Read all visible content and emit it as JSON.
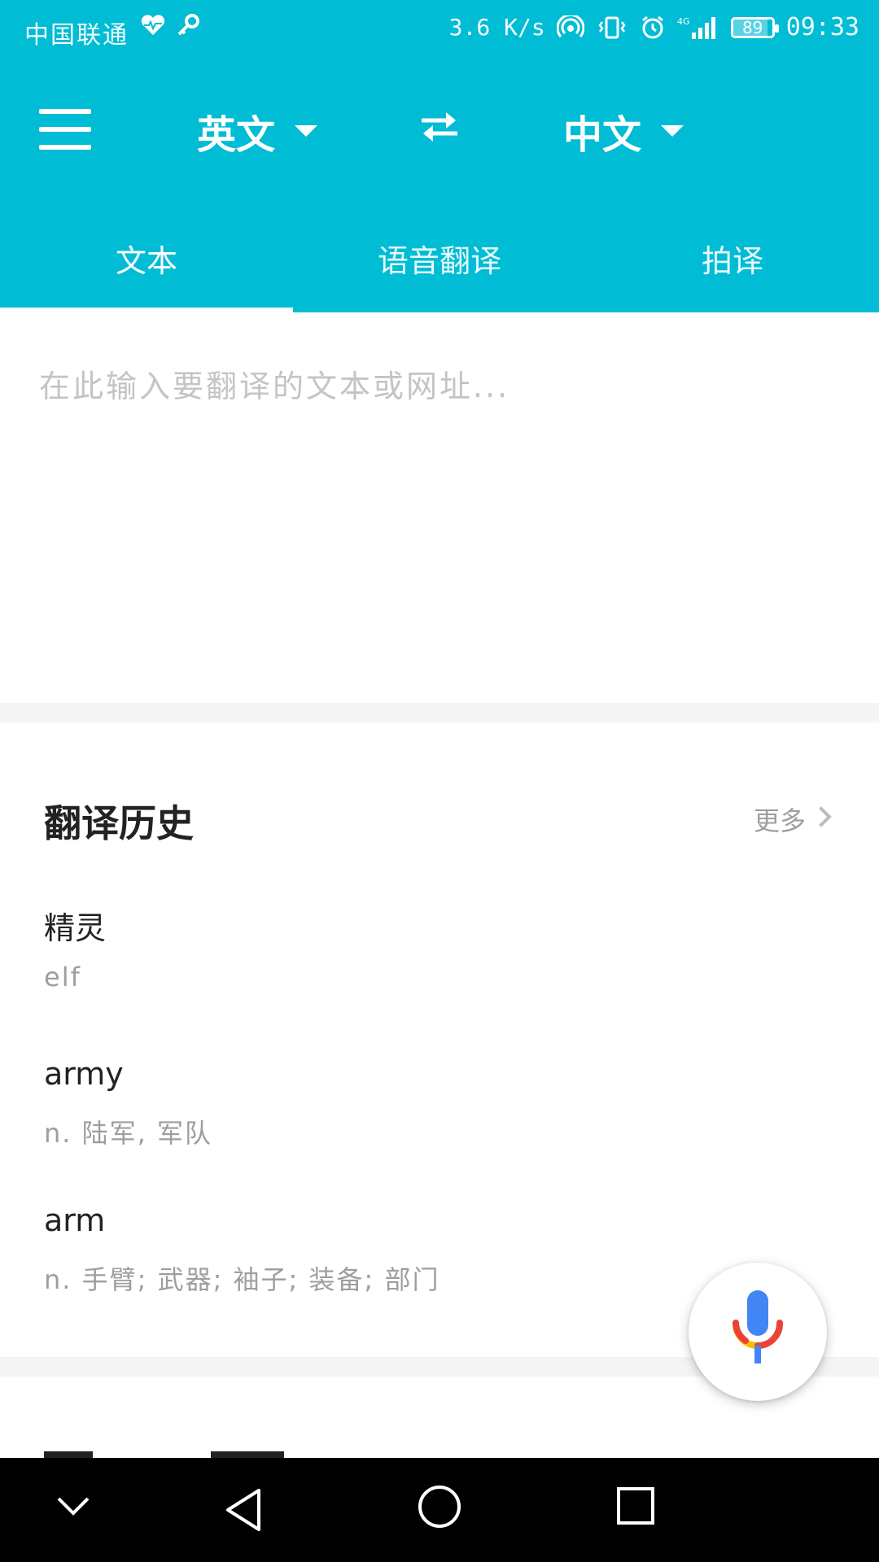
{
  "status_bar": {
    "carrier": "中国联通",
    "speed": "3.6 K/s",
    "network": "4G",
    "battery": "89",
    "battery_percent": 89,
    "time": "09:33"
  },
  "toolbar": {
    "source_lang": "英文",
    "target_lang": "中文"
  },
  "tabs": [
    {
      "label": "文本",
      "active": true
    },
    {
      "label": "语音翻译",
      "active": false
    },
    {
      "label": "拍译",
      "active": false
    }
  ],
  "input": {
    "placeholder": "在此输入要翻译的文本或网址..."
  },
  "history": {
    "title": "翻译历史",
    "more_label": "更多",
    "items": [
      {
        "source": "精灵",
        "translation": "elf"
      },
      {
        "source": "army",
        "translation": "n. 陆军, 军队"
      },
      {
        "source": "arm",
        "translation": "n. 手臂; 武器; 袖子; 装备; 部门"
      }
    ]
  },
  "colors": {
    "primary": "#00BCD4",
    "mic_blue": "#4285F4",
    "mic_red": "#EA4335",
    "mic_yellow": "#FBBC05",
    "mic_green": "#34A853"
  }
}
